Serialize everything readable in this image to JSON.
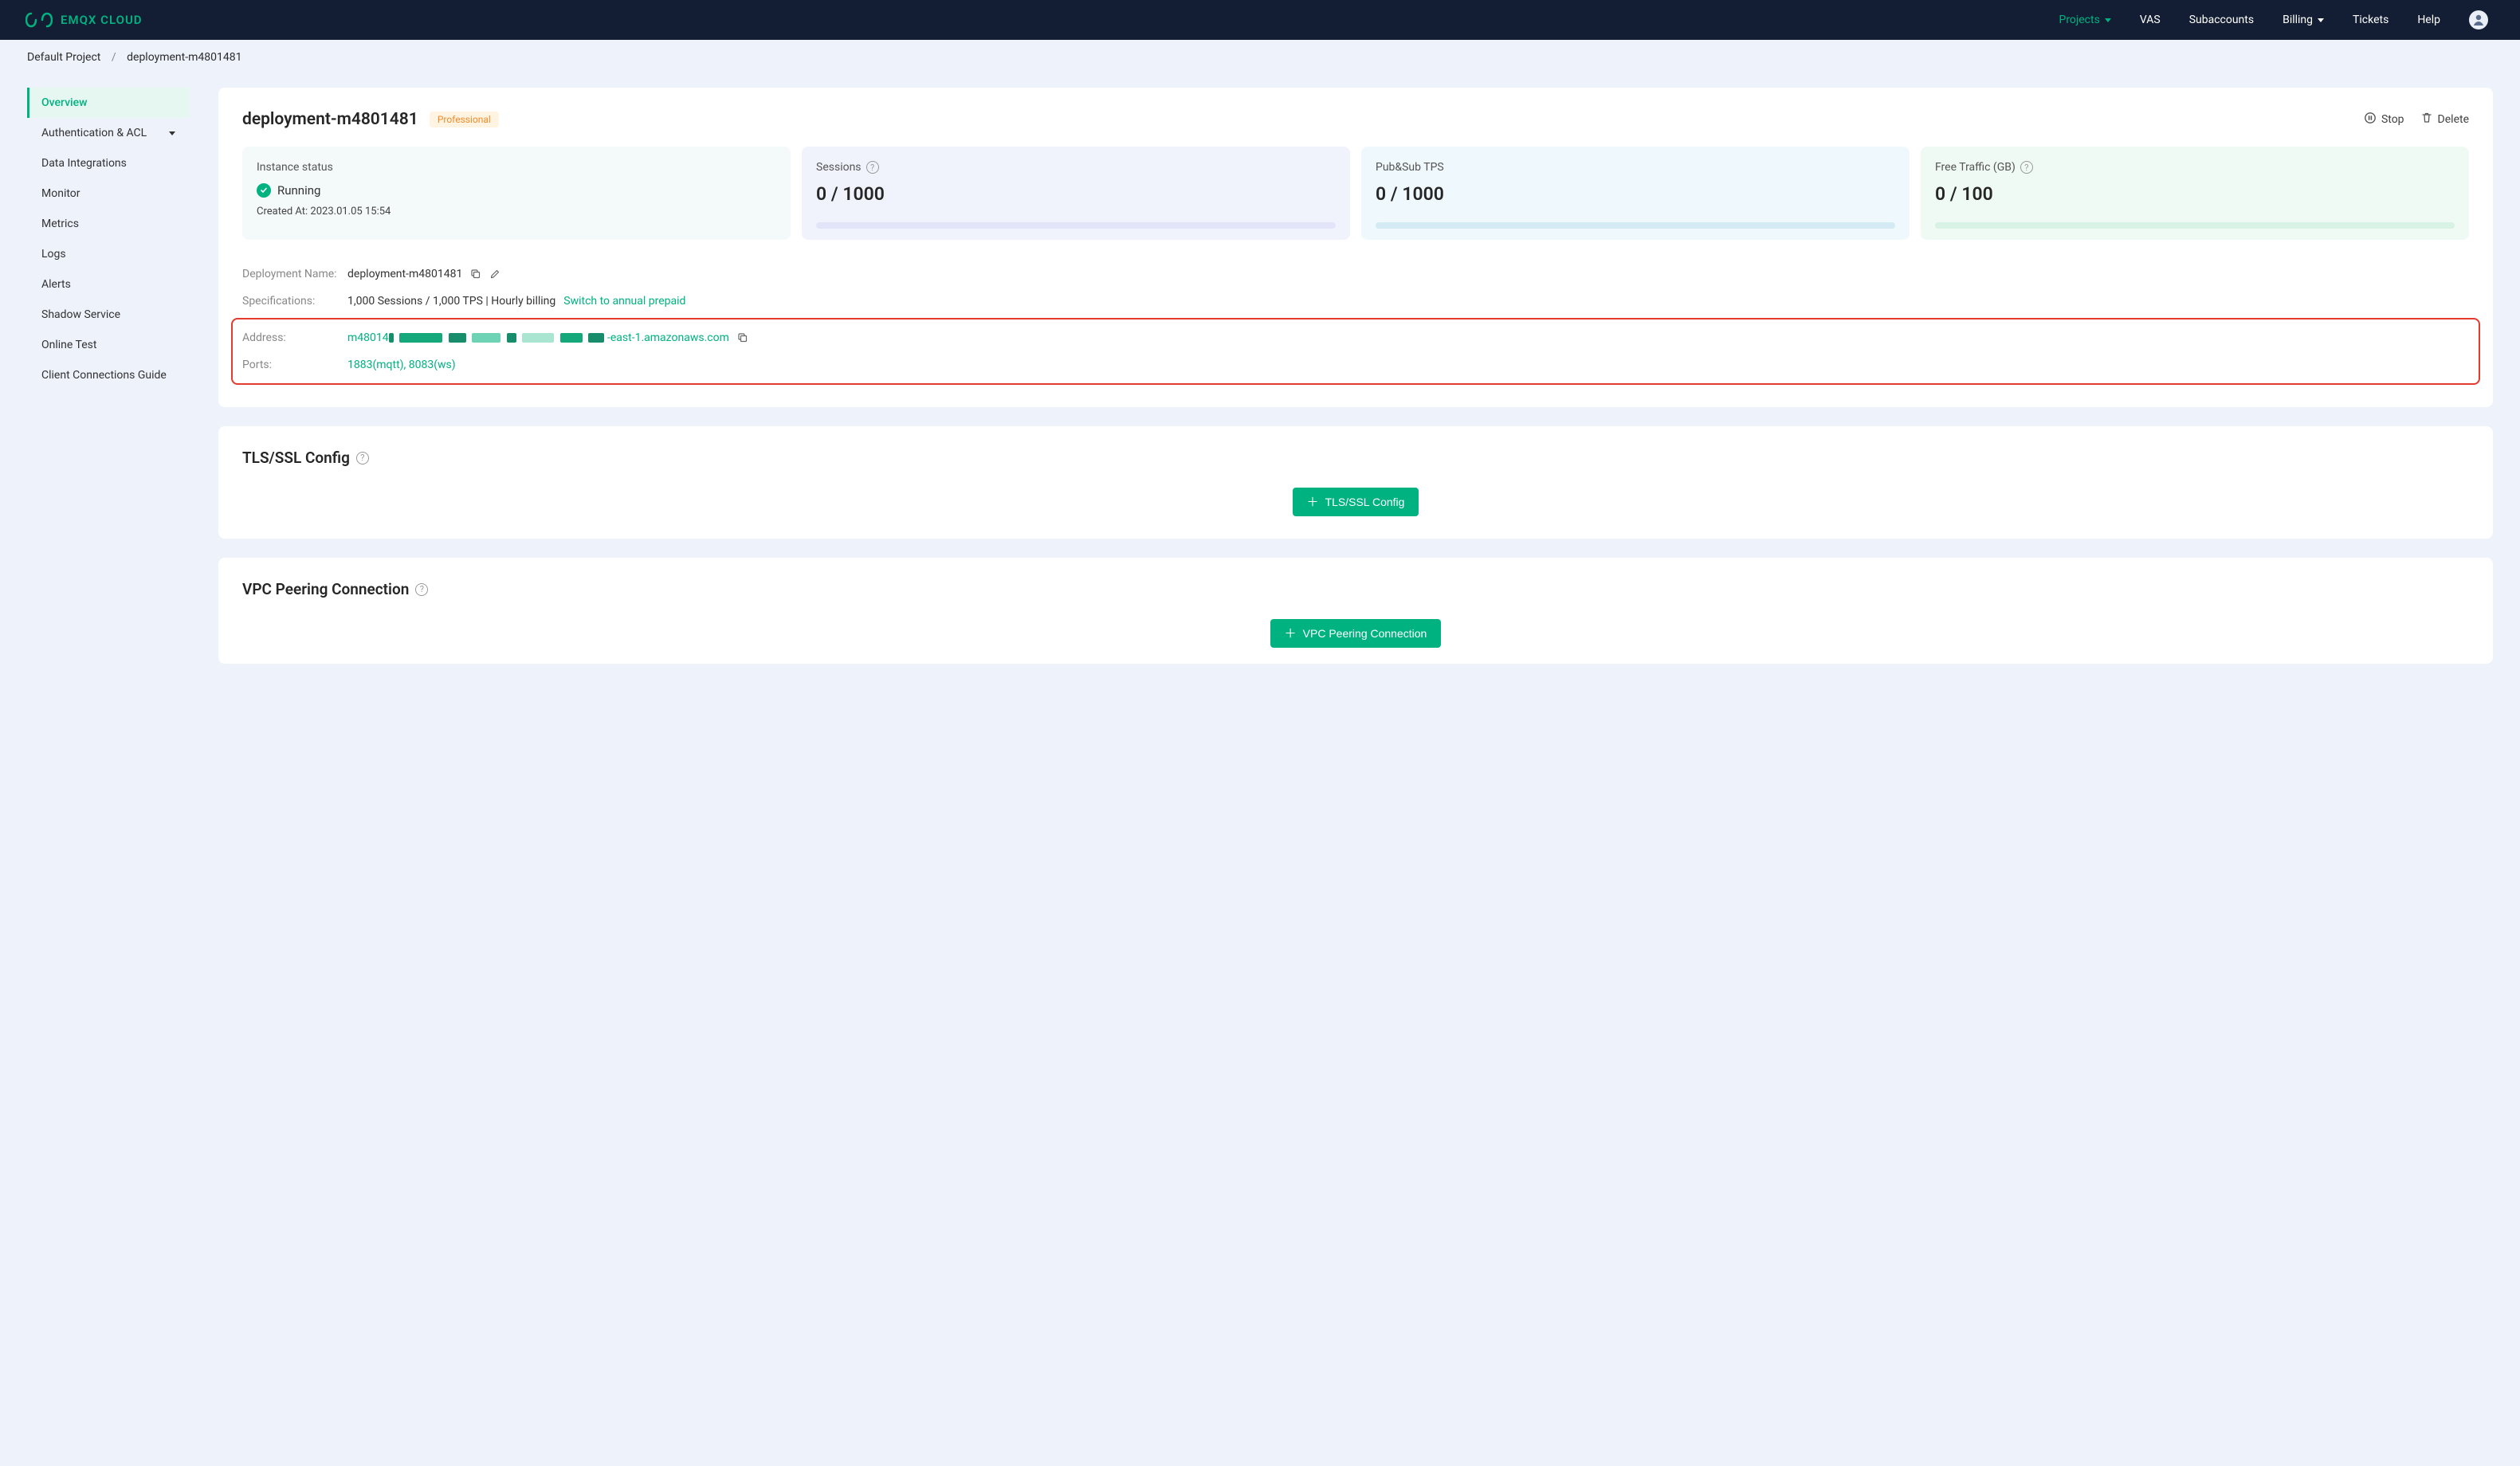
{
  "brand": "EMQX CLOUD",
  "nav": {
    "projects": "Projects",
    "vas": "VAS",
    "subaccounts": "Subaccounts",
    "billing": "Billing",
    "tickets": "Tickets",
    "help": "Help"
  },
  "crumbs": {
    "root": "Default Project",
    "current": "deployment-m4801481"
  },
  "sidebar": {
    "overview": "Overview",
    "auth": "Authentication & ACL",
    "data_int": "Data Integrations",
    "monitor": "Monitor",
    "metrics": "Metrics",
    "logs": "Logs",
    "alerts": "Alerts",
    "shadow": "Shadow Service",
    "online_test": "Online Test",
    "client_conn": "Client Connections Guide"
  },
  "header": {
    "title": "deployment-m4801481",
    "badge": "Professional",
    "stop": "Stop",
    "delete": "Delete"
  },
  "stats": {
    "instance": {
      "title": "Instance status",
      "status": "Running",
      "created_lbl": "Created At:",
      "created_val": "2023.01.05 15:54"
    },
    "sessions": {
      "title": "Sessions",
      "value": "0 / 1000"
    },
    "pubsub": {
      "title": "Pub&Sub TPS",
      "value": "0 / 1000"
    },
    "traffic": {
      "title": "Free Traffic (GB)",
      "value": "0 / 100"
    }
  },
  "info": {
    "name_lbl": "Deployment Name:",
    "name_val": "deployment-m4801481",
    "spec_lbl": "Specifications:",
    "spec_val": "1,000 Sessions / 1,000 TPS | Hourly billing",
    "spec_link": "Switch to annual prepaid",
    "addr_lbl": "Address:",
    "addr_prefix": "m48014",
    "addr_suffix": "-east-1.amazonaws.com",
    "ports_lbl": "Ports:",
    "ports_val": "1883(mqtt), 8083(ws)"
  },
  "tls": {
    "title": "TLS/SSL Config",
    "button": "TLS/SSL Config"
  },
  "vpc": {
    "title": "VPC Peering Connection",
    "button": "VPC Peering Connection"
  }
}
